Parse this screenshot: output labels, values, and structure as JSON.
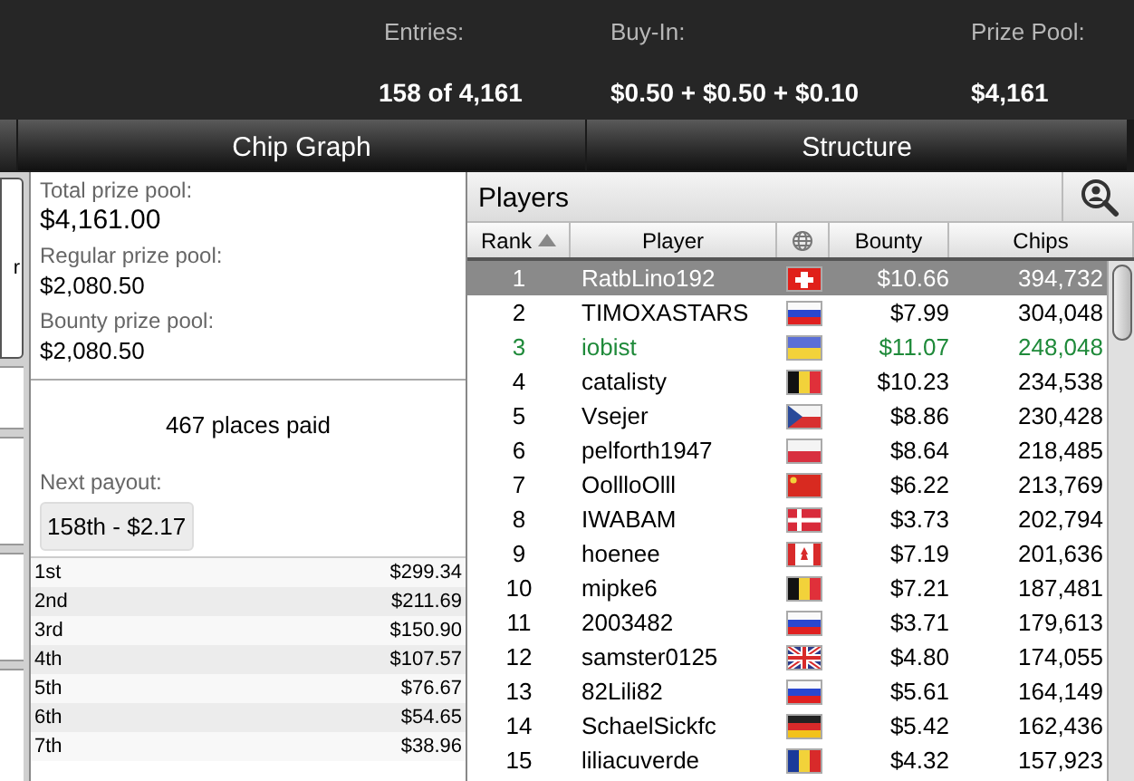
{
  "header": {
    "stats": [
      {
        "label": "Entries:",
        "value": "158 of 4,161"
      },
      {
        "label": "Buy-In:",
        "value": "$0.50 + $0.50 + $0.10"
      },
      {
        "label": "Prize Pool:",
        "value": "$4,161"
      }
    ]
  },
  "tabs": [
    {
      "label": "Chip Graph",
      "selected": false
    },
    {
      "label": "Structure",
      "selected": false
    }
  ],
  "left_fragment": "r",
  "prize_info": {
    "pools": [
      {
        "label": "Total prize pool:",
        "value": "$4,161.00"
      },
      {
        "label": "Regular prize pool:",
        "value": "$2,080.50"
      },
      {
        "label": "Bounty prize pool:",
        "value": "$2,080.50"
      }
    ],
    "places_paid": "467 places paid",
    "next_payout_label": "Next payout:",
    "next_payout": "158th - $2.17"
  },
  "payouts": [
    {
      "place": "1st",
      "amount": "$299.34"
    },
    {
      "place": "2nd",
      "amount": "$211.69"
    },
    {
      "place": "3rd",
      "amount": "$150.90"
    },
    {
      "place": "4th",
      "amount": "$107.57"
    },
    {
      "place": "5th",
      "amount": "$76.67"
    },
    {
      "place": "6th",
      "amount": "$54.65"
    },
    {
      "place": "7th",
      "amount": "$38.96"
    }
  ],
  "players": {
    "title": "Players",
    "columns": [
      "Rank",
      "Player",
      "Bounty",
      "Chips"
    ],
    "rows": [
      {
        "rank": "1",
        "player": "RatbLino192",
        "kind": "ch",
        "bounty": "$10.66",
        "chips": "394,732",
        "selected": true,
        "own": false
      },
      {
        "rank": "2",
        "player": "TIMOXASTARS",
        "kind": "ru",
        "bounty": "$7.99",
        "chips": "304,048",
        "selected": false,
        "own": false
      },
      {
        "rank": "3",
        "player": "iobist",
        "kind": "ua",
        "bounty": "$11.07",
        "chips": "248,048",
        "selected": false,
        "own": true
      },
      {
        "rank": "4",
        "player": "catalisty",
        "kind": "be",
        "bounty": "$10.23",
        "chips": "234,538",
        "selected": false,
        "own": false
      },
      {
        "rank": "5",
        "player": "Vsejer",
        "kind": "cz",
        "bounty": "$8.86",
        "chips": "230,428",
        "selected": false,
        "own": false
      },
      {
        "rank": "6",
        "player": "pelforth1947",
        "kind": "pl",
        "bounty": "$8.64",
        "chips": "218,485",
        "selected": false,
        "own": false
      },
      {
        "rank": "7",
        "player": "OollloOlll",
        "kind": "cn",
        "bounty": "$6.22",
        "chips": "213,769",
        "selected": false,
        "own": false
      },
      {
        "rank": "8",
        "player": "IWABAM",
        "kind": "dk",
        "bounty": "$3.73",
        "chips": "202,794",
        "selected": false,
        "own": false
      },
      {
        "rank": "9",
        "player": "hoenee",
        "kind": "ca",
        "bounty": "$7.19",
        "chips": "201,636",
        "selected": false,
        "own": false
      },
      {
        "rank": "10",
        "player": "mipke6",
        "kind": "be",
        "bounty": "$7.21",
        "chips": "187,481",
        "selected": false,
        "own": false
      },
      {
        "rank": "11",
        "player": "2003482",
        "kind": "ru",
        "bounty": "$3.71",
        "chips": "179,613",
        "selected": false,
        "own": false
      },
      {
        "rank": "12",
        "player": "samster0125",
        "kind": "gb",
        "bounty": "$4.80",
        "chips": "174,055",
        "selected": false,
        "own": false
      },
      {
        "rank": "13",
        "player": "82Lili82",
        "kind": "ru",
        "bounty": "$5.61",
        "chips": "164,149",
        "selected": false,
        "own": false
      },
      {
        "rank": "14",
        "player": "SchaelSickfc",
        "kind": "de",
        "bounty": "$5.42",
        "chips": "162,436",
        "selected": false,
        "own": false
      },
      {
        "rank": "15",
        "player": "liliacuverde",
        "kind": "ro",
        "bounty": "$4.32",
        "chips": "157,923",
        "selected": false,
        "own": false
      }
    ]
  }
}
